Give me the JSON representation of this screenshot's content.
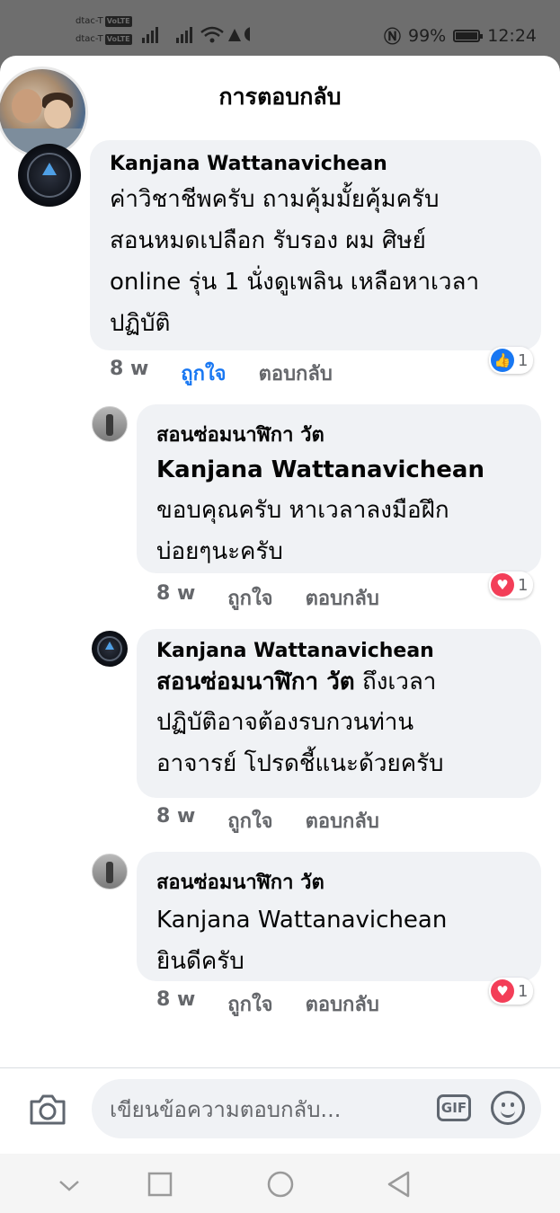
{
  "status_bar": {
    "carrier1": "dtac-T",
    "carrier2": "dtac-T",
    "volte": "VoLTE",
    "battery": "99%",
    "battery_level": 0.99,
    "time": "12:24"
  },
  "header": {
    "title": "การตอบกลับ"
  },
  "comments": [
    {
      "author": "Kanjana Wattanavichean",
      "lines": [
        "ค่าวิชาชีพครับ ถามคุ้มมั้ยคุ้มครับ",
        "สอนหมดเปลือก รับรอง ผม ศิษย์",
        "online รุ่น 1 นั่งดูเพลิน เหลือหาเวลา",
        "ปฏิบัติ"
      ],
      "time": "8 w",
      "like": "ถูกใจ",
      "reply": "ตอบกลับ",
      "reaction_type": "like-icon",
      "reaction_count": "1"
    },
    {
      "author": "สอนซ่อมนาฬิกา วัต",
      "mention": "Kanjana Wattanavichean",
      "lines": [
        "ขอบคุณครับ หาเวลาลงมือฝึก",
        "บ่อยๆนะครับ"
      ],
      "time": "8 w",
      "like": "ถูกใจ",
      "reply": "ตอบกลับ",
      "reaction_type": "heart-icon",
      "reaction_count": "1"
    },
    {
      "author": "Kanjana Wattanavichean",
      "mention": "สอนซ่อมนาฬิกา วัต",
      "lines": [
        " ถึงเวลา",
        "ปฏิบัติอาจต้องรบกวนท่าน",
        "อาจารย์ โปรดชี้แนะด้วยครับ"
      ],
      "time": "8 w",
      "like": "ถูกใจ",
      "reply": "ตอบกลับ"
    },
    {
      "author": "สอนซ่อมนาฬิกา วัต",
      "lines": [
        "Kanjana Wattanavichean",
        "ยินดีครับ"
      ],
      "time": "8 w",
      "like": "ถูกใจ",
      "reply": "ตอบกลับ",
      "reaction_type": "heart-icon",
      "reaction_count": "1"
    }
  ],
  "composer": {
    "placeholder": "เขียนข้อความตอบกลับ...",
    "gif_label": "GIF"
  },
  "colors": {
    "accent": "#1877f2",
    "love": "#f33e58",
    "bubble": "#f0f2f5",
    "meta": "#65676b"
  }
}
